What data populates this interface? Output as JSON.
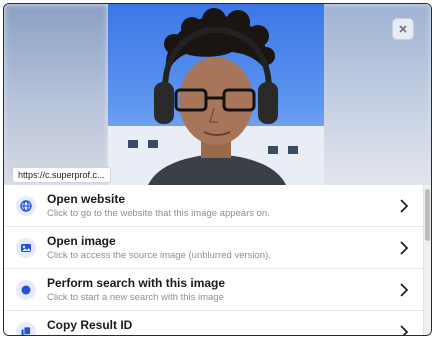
{
  "preview": {
    "url_label": "https://c.superprof.c...",
    "close_icon": "close-icon"
  },
  "menu": {
    "items": [
      {
        "title": "Open website",
        "subtitle": "Click to go to the website that this image appears on.",
        "icon": "globe-icon"
      },
      {
        "title": "Open image",
        "subtitle": "Click to access the source image (unblurred version).",
        "icon": "image-icon"
      },
      {
        "title": "Perform search with this image",
        "subtitle": "Click to start a new search with this image",
        "icon": "search-dot-icon"
      },
      {
        "title": "Copy Result ID",
        "subtitle": "",
        "icon": "copy-icon"
      }
    ]
  },
  "colors": {
    "accent": "#2453d6",
    "icon_bg": "#e5ebfb",
    "title": "#1b1b1b",
    "subtitle": "#8a8f98"
  }
}
